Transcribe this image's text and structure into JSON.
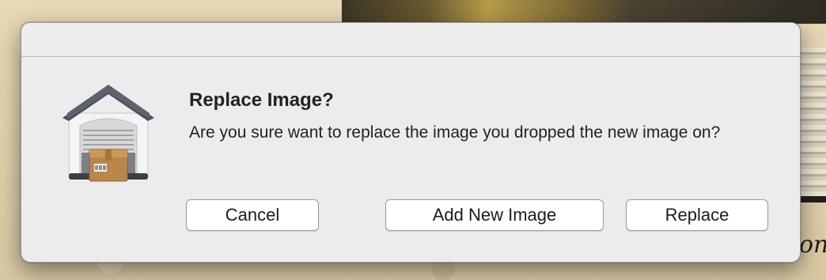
{
  "dialog": {
    "title": "Replace Image?",
    "message": "Are you sure want to replace the image you dropped the new image on?",
    "icon": "garage-box-app-icon",
    "buttons": {
      "cancel": "Cancel",
      "add_new": "Add New Image",
      "replace": "Replace"
    }
  },
  "background": {
    "edge_text": "on"
  }
}
